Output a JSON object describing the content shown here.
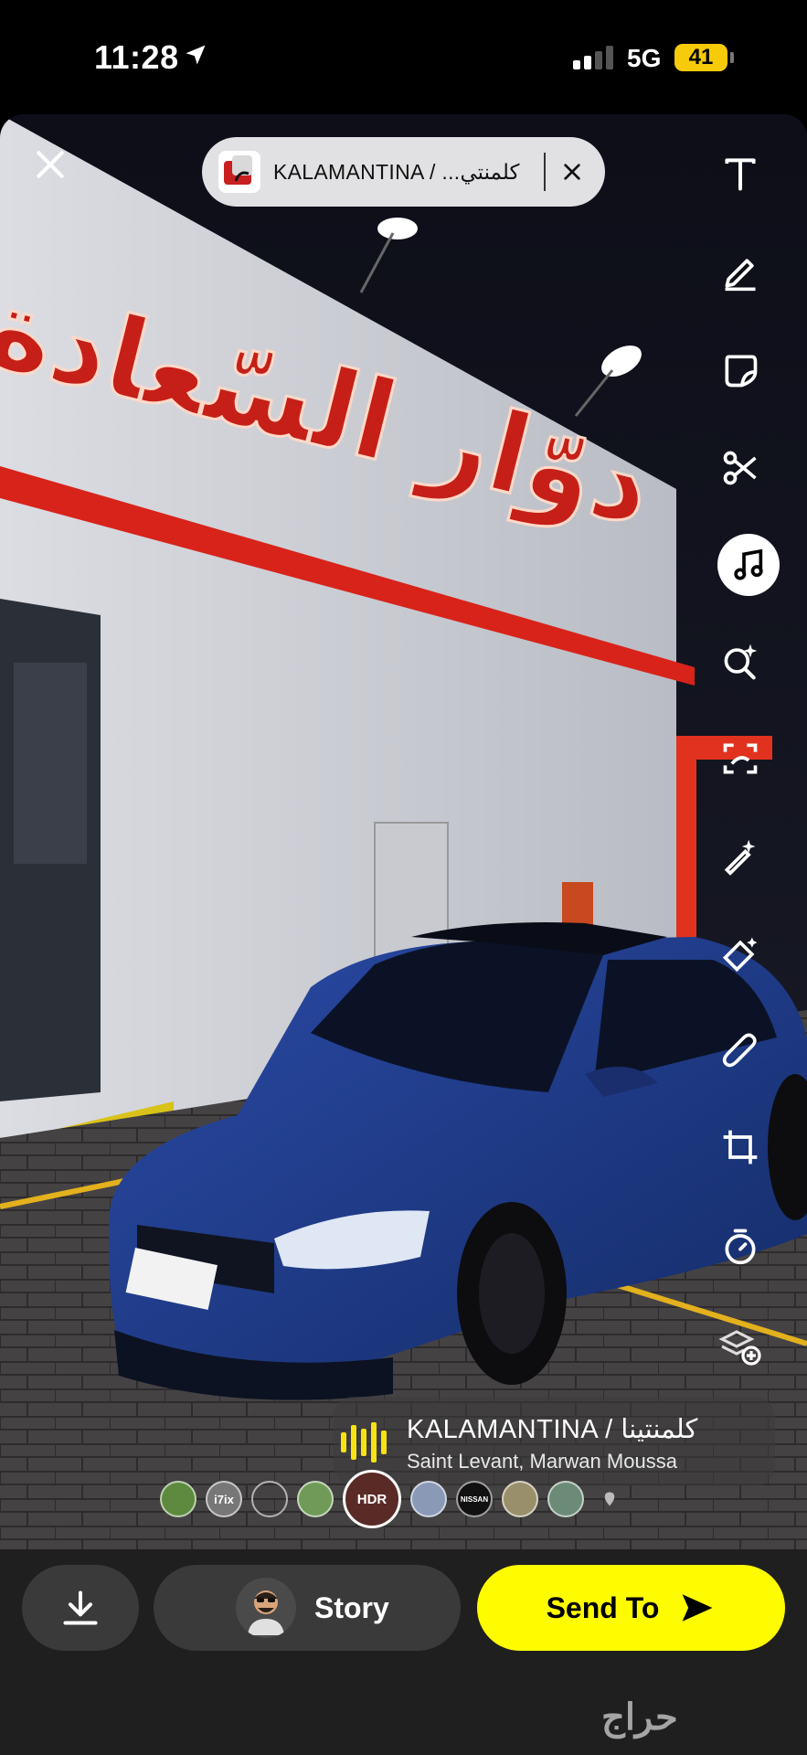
{
  "status_bar": {
    "time": "11:28",
    "network": "5G",
    "battery": "41"
  },
  "music_pill": {
    "title": "KALAMANTINA / ...كلمنتي"
  },
  "photo": {
    "sign_text": "دوّار السّعادة"
  },
  "toolbar": {
    "tools": [
      "text-icon",
      "pen-icon",
      "sticker-icon",
      "scissors-icon",
      "music-icon",
      "lens-search-icon",
      "scan-icon",
      "magic-wand-icon",
      "eraser-icon",
      "paperclip-icon",
      "crop-icon",
      "timer-icon",
      "layers-add-icon"
    ]
  },
  "music_card": {
    "song": "KALAMANTINA / كلمنتينا",
    "artist": "Saint Levant, Marwan Moussa"
  },
  "stickers": {
    "items": [
      "",
      "",
      "i7ix",
      "",
      "",
      "HDR",
      "",
      "NISSAN",
      "",
      "",
      ""
    ]
  },
  "bottom": {
    "story_label": "Story",
    "send_label": "Send To"
  },
  "watermark": "حراج",
  "colors": {
    "send_yellow": "#fffc00",
    "battery_yellow": "#f7cb0a",
    "car_blue": "#1e3a86",
    "sign_red": "#d8231a"
  }
}
